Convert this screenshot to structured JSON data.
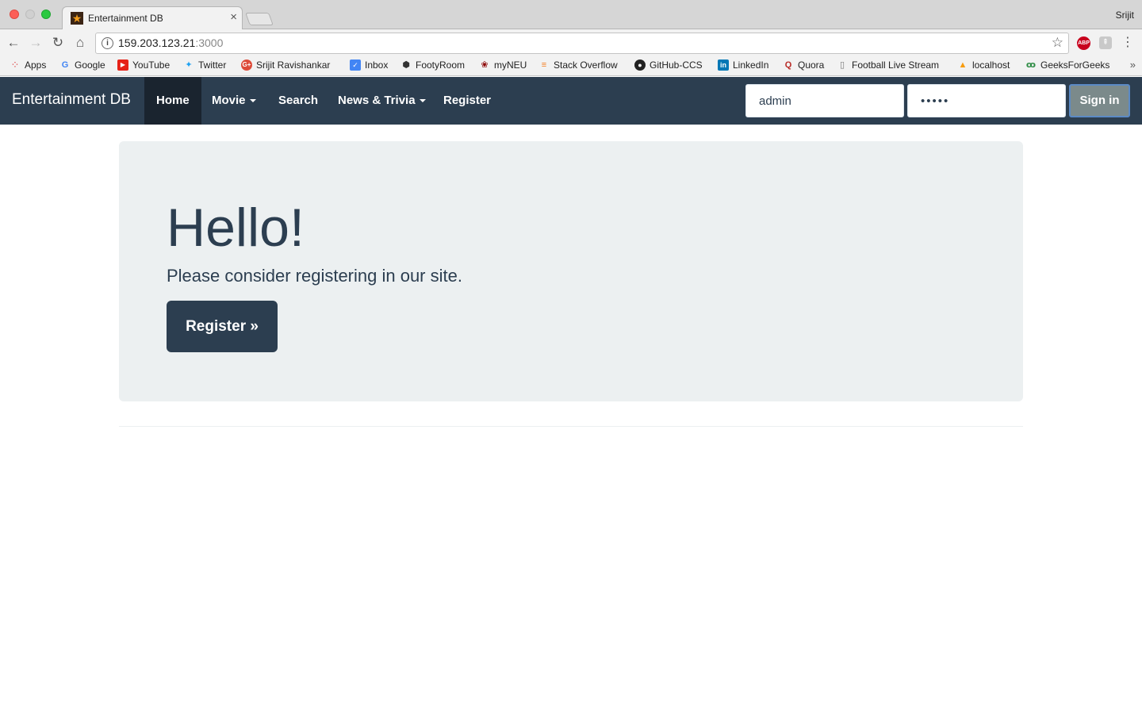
{
  "browser": {
    "tab_title": "Entertainment DB",
    "tab_close": "×",
    "profile_name": "Srijit",
    "url_host": "159.203.123.21",
    "url_port": ":3000",
    "ext_abp": "ABP",
    "bookmarks": [
      {
        "label": "Apps",
        "icon": "apps-grid-icon"
      },
      {
        "label": "Google",
        "icon": "google-icon"
      },
      {
        "label": "YouTube",
        "icon": "youtube-icon"
      },
      {
        "label": "Twitter",
        "icon": "twitter-icon"
      },
      {
        "label": "Srijit Ravishankar",
        "icon": "google-plus-icon"
      },
      {
        "label": "Inbox",
        "icon": "inbox-icon"
      },
      {
        "label": "FootyRoom",
        "icon": "footyroom-icon"
      },
      {
        "label": "myNEU",
        "icon": "paw-icon"
      },
      {
        "label": "Stack Overflow",
        "icon": "stackoverflow-icon"
      },
      {
        "label": "GitHub-CCS",
        "icon": "github-icon"
      },
      {
        "label": "LinkedIn",
        "icon": "linkedin-icon"
      },
      {
        "label": "Quora",
        "icon": "quora-icon"
      },
      {
        "label": "Football Live Stream",
        "icon": "page-icon"
      },
      {
        "label": "localhost",
        "icon": "phpmyadmin-icon"
      },
      {
        "label": "GeeksForGeeks",
        "icon": "geeksforgeeks-icon"
      }
    ],
    "bookmarks_more": "»"
  },
  "navbar": {
    "brand": "Entertainment DB",
    "links": {
      "home": "Home",
      "movie": "Movie",
      "search": "Search",
      "news": "News & Trivia",
      "register": "Register"
    },
    "username_value": "admin",
    "password_value": "•••••",
    "signin_label": "Sign in"
  },
  "jumbotron": {
    "heading": "Hello!",
    "text": "Please consider registering in our site.",
    "button": "Register »"
  },
  "colors": {
    "navbar": "#2c3e50",
    "navbar_active": "#1a242f",
    "jumbotron": "#ecf0f1",
    "signin_button": "#7b8a8b"
  }
}
